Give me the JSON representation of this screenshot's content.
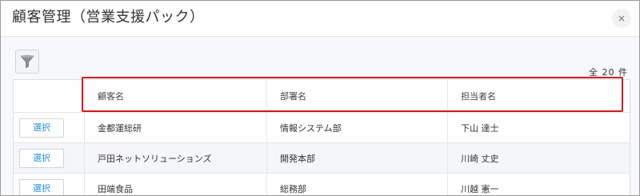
{
  "dialog": {
    "title": "顧客管理（営業支援パック）",
    "close_label": "×"
  },
  "toolbar": {
    "filter_icon": "funnel-icon",
    "total_count": "全 20 件"
  },
  "table": {
    "columns": [
      "顧客名",
      "部署名",
      "担当者名"
    ],
    "rows": [
      {
        "select_label": "選択",
        "customer": "金都運総研",
        "department": "情報システム部",
        "person": "下山 達士"
      },
      {
        "select_label": "選択",
        "customer": "戸田ネットソリューションズ",
        "department": "開発本部",
        "person": "川崎 丈史"
      },
      {
        "select_label": "選択",
        "customer": "田端食品",
        "department": "総務部",
        "person": "川越 憲一"
      }
    ]
  },
  "colors": {
    "highlight": "#d2191e",
    "link_blue": "#2a8fd6"
  }
}
